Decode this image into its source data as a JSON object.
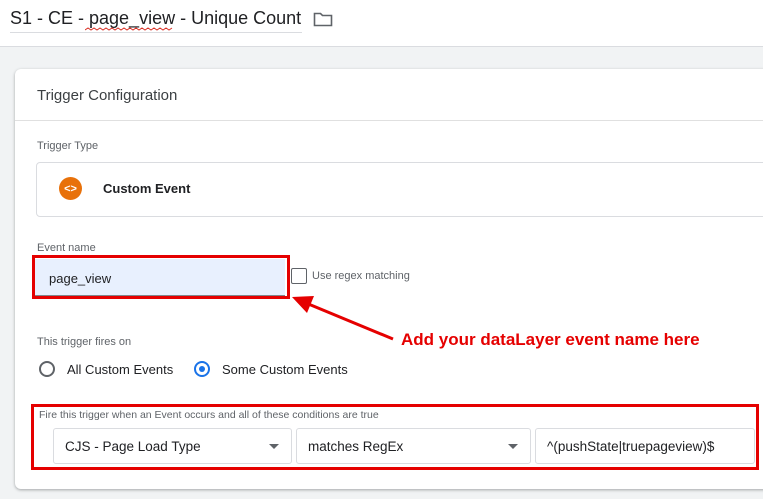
{
  "header": {
    "title": "S1 - CE - page_view - Unique Count",
    "folder_icon": "folder-icon"
  },
  "card": {
    "title": "Trigger Configuration",
    "trigger_type_label": "Trigger Type",
    "trigger_type": {
      "icon": "custom-event-icon",
      "icon_glyph": "<>",
      "icon_color": "#e8710a",
      "name": "Custom Event"
    },
    "event_name_label": "Event name",
    "event_name_value": "page_view",
    "regex_checkbox": {
      "label": "Use regex matching",
      "checked": false
    },
    "fires_on_label": "This trigger fires on",
    "fires_on_options": [
      {
        "label": "All Custom Events",
        "selected": false
      },
      {
        "label": "Some Custom Events",
        "selected": true
      }
    ],
    "condition": {
      "label": "Fire this trigger when an Event occurs and all of these conditions are true",
      "variable": "CJS - Page Load Type",
      "operator": "matches RegEx",
      "value": "^(pushState|truepageview)$"
    }
  },
  "annotation": {
    "text": "Add your dataLayer event name here",
    "color": "#e50000"
  }
}
